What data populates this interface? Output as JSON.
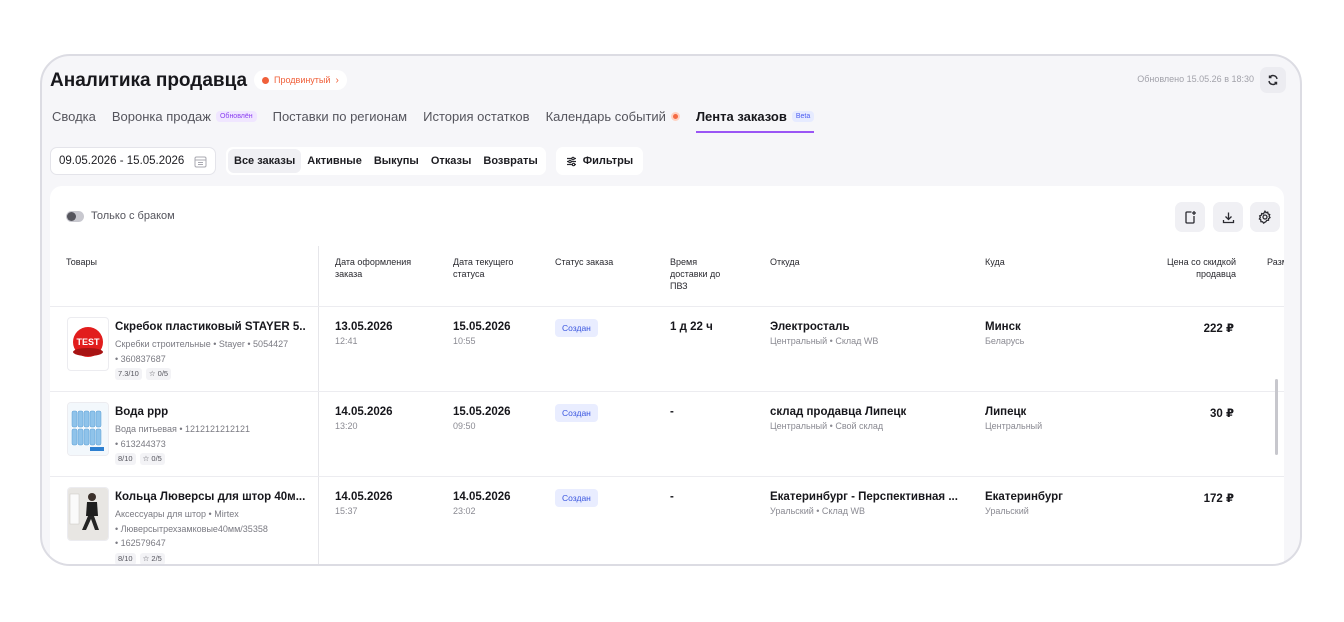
{
  "header": {
    "title": "Аналитика продавца",
    "tier_label": "Продвинутый",
    "updated_text": "Обновлено 15.05.26 в 18:30"
  },
  "tabs": [
    {
      "label": "Сводка"
    },
    {
      "label": "Воронка продаж",
      "badge": "Обновлён"
    },
    {
      "label": "Поставки по регионам"
    },
    {
      "label": "История остатков"
    },
    {
      "label": "Календарь событий"
    },
    {
      "label": "Лента заказов",
      "badge": "Beta",
      "active": true
    }
  ],
  "toolbar": {
    "date_range": "09.05.2026 - 15.05.2026",
    "segments": [
      "Все заказы",
      "Активные",
      "Выкупы",
      "Отказы",
      "Возвраты"
    ],
    "filters_label": "Фильтры"
  },
  "panel": {
    "defect_toggle_label": "Только с браком"
  },
  "table": {
    "columns": {
      "goods": "Товары",
      "order_date": "Дата оформления заказа",
      "status_date": "Дата текущего статуса",
      "order_status": "Статус заказа",
      "delivery_time": "Время доставки до ПВЗ",
      "from": "Откуда",
      "to": "Куда",
      "price": "Цена со скидкой продавца",
      "size": "Разм"
    },
    "rows": [
      {
        "name": "Скребок пластиковый STAYER 5...",
        "meta1": "Скребки строительные • Stayer • 5054427",
        "meta2": "• 360837687",
        "rating_score": "7.3/10",
        "rating_stars": "☆ 0/5",
        "order_date": "13.05.2026",
        "order_time": "12:41",
        "status_date": "15.05.2026",
        "status_time": "10:55",
        "status": "Создан",
        "delivery": "1 д 22 ч",
        "from_main": "Электросталь",
        "from_sub": "Центральный • Склад WB",
        "to_main": "Минск",
        "to_sub": "Беларусь",
        "price": "222 ₽",
        "thumb_text": "TEST"
      },
      {
        "name": "Вода ррр",
        "meta1": "Вода питьевая • 1212121212121",
        "meta2": "• 613244373",
        "rating_score": "8/10",
        "rating_stars": "☆ 0/5",
        "order_date": "14.05.2026",
        "order_time": "13:20",
        "status_date": "15.05.2026",
        "status_time": "09:50",
        "status": "Создан",
        "delivery": "-",
        "from_main": "склад продавца Липецк",
        "from_sub": "Центральный • Свой склад",
        "to_main": "Липецк",
        "to_sub": "Центральный",
        "price": "30 ₽"
      },
      {
        "name": "Кольца Люверсы для штор 40м...",
        "meta1": "Аксессуары для штор • Mirtex",
        "meta2": "• Люверсытрехзамковые40мм/35358",
        "meta3": "• 162579647",
        "rating_score": "8/10",
        "rating_stars": "☆ 2/5",
        "order_date": "14.05.2026",
        "order_time": "15:37",
        "status_date": "14.05.2026",
        "status_time": "23:02",
        "status": "Создан",
        "delivery": "-",
        "from_main": "Екатеринбург - Перспективная ...",
        "from_sub": "Уральский • Склад WB",
        "to_main": "Екатеринбург",
        "to_sub": "Уральский",
        "price": "172 ₽"
      }
    ]
  },
  "colors": {
    "accent": "#9a55f5",
    "tier": "#f0603a",
    "status_bg": "#e9edff",
    "status_text": "#3b57e0"
  },
  "icons": [
    "refresh-icon",
    "calendar-icon",
    "filters-icon",
    "new-doc-icon",
    "download-icon",
    "settings-icon"
  ]
}
